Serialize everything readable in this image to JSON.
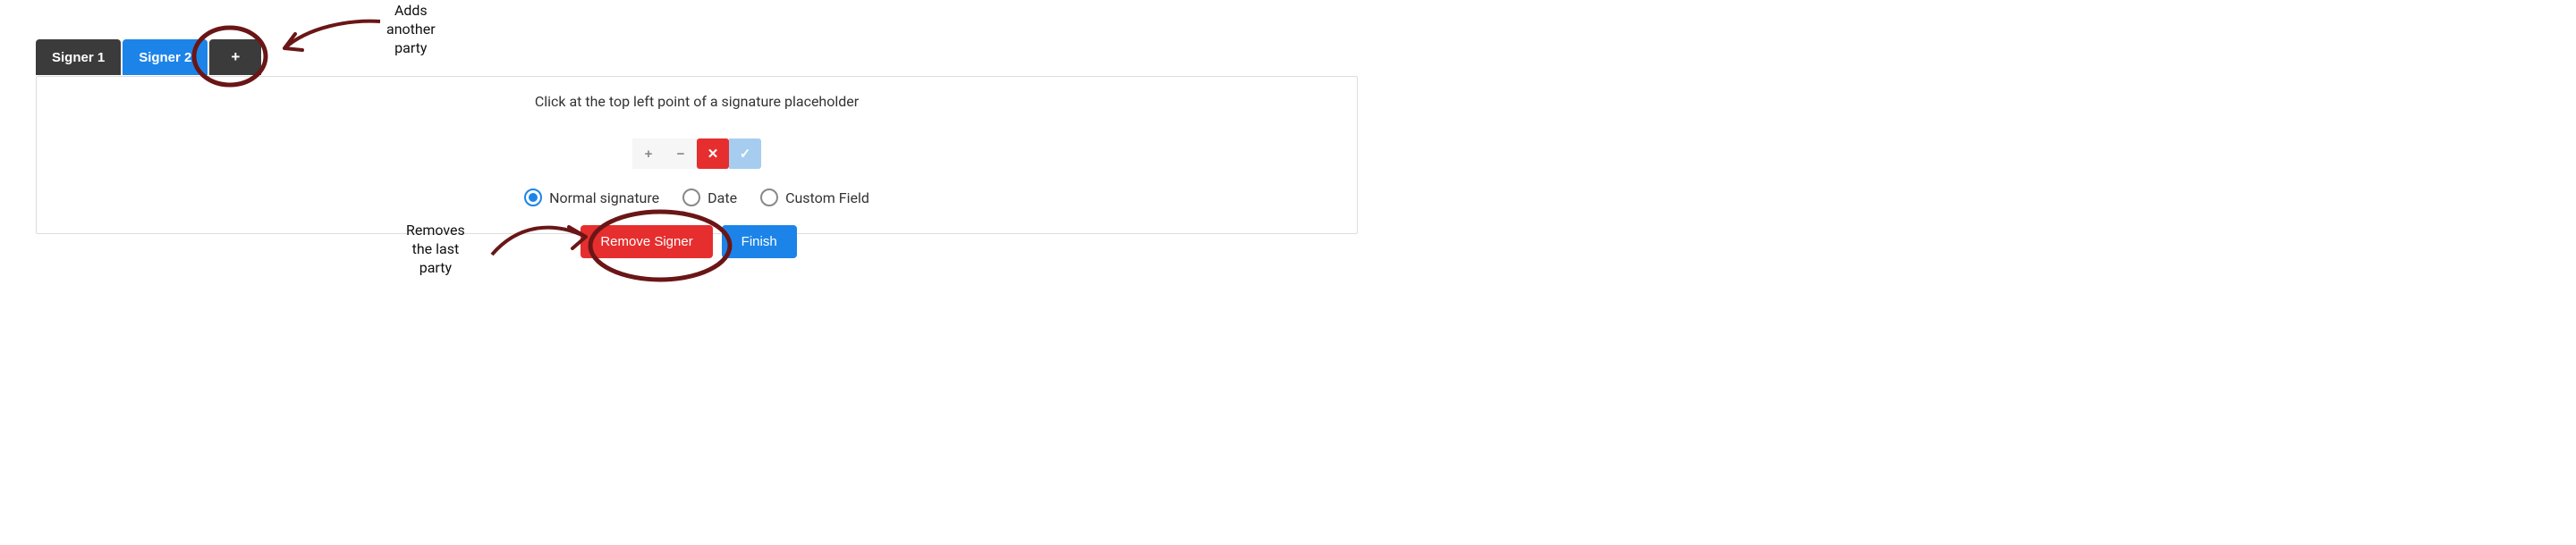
{
  "tabs": [
    {
      "label": "Signer 1"
    },
    {
      "label": "Signer 2"
    },
    {
      "label": "+"
    }
  ],
  "panel": {
    "instruction": "Click at the top left point of a signature placeholder"
  },
  "toolbar": {
    "zoom_in": "+",
    "zoom_out": "−",
    "cancel": "✕",
    "confirm": "✓"
  },
  "radios": {
    "normal": "Normal signature",
    "date": "Date",
    "custom": "Custom Field"
  },
  "buttons": {
    "remove": "Remove Signer",
    "finish": "Finish"
  },
  "annotations": {
    "add_party": "Adds\nanother\nparty",
    "remove_party": "Removes\nthe last\nparty"
  },
  "colors": {
    "annotation": "#6a1616"
  }
}
